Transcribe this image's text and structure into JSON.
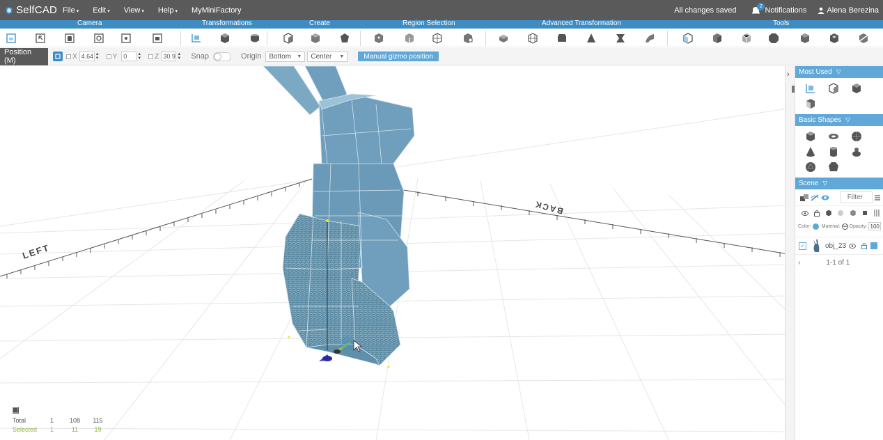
{
  "app": {
    "name": "SelfCAD"
  },
  "menu": [
    {
      "label": "File",
      "caret": "▾"
    },
    {
      "label": "Edit",
      "caret": "▾"
    },
    {
      "label": "View",
      "caret": "▾"
    },
    {
      "label": "Help",
      "caret": "▾"
    },
    {
      "label": "MyMiniFactory",
      "caret": ""
    }
  ],
  "status": {
    "saved": "All changes saved",
    "notifications": "Notifications",
    "notification_count": "2",
    "user": "Alena Berezina"
  },
  "categories": [
    "Camera",
    "Transformations",
    "Create",
    "Region Selection",
    "Advanced Transformation",
    "Tools"
  ],
  "position_bar": {
    "tab_label": "Position (M)",
    "x_label": "X",
    "x_value": "4.64",
    "y_label": "Y",
    "y_value": "0",
    "z_label": "Z",
    "z_value": "30.9!",
    "snap_label": "Snap",
    "origin_label": "Origin",
    "origin_vertical": "Bottom",
    "origin_horizontal": "Center",
    "gizmo_button": "Manual gizmo position"
  },
  "viewport": {
    "label_left": "LEFT",
    "label_back": "BACK",
    "stats": {
      "total_label": "Total",
      "total": [
        "1",
        "108",
        "115"
      ],
      "selected_label": "Selected",
      "selected": [
        "1",
        "11",
        "19"
      ]
    }
  },
  "panel": {
    "most_used": "Most Used",
    "basic_shapes": "Basic Shapes",
    "scene": "Scene",
    "filter_placeholder": "Filter",
    "color_label": "Color:",
    "material_label": "Material:",
    "opacity_label": "Opacity:",
    "opacity_value": "100",
    "object_name": "obj_23",
    "pager": "1-1 of 1"
  },
  "colors": {
    "accent": "#3d8cc4",
    "topbar": "#5a5a5a",
    "model": "#6f9fbd",
    "selection": "#8ab13c"
  }
}
